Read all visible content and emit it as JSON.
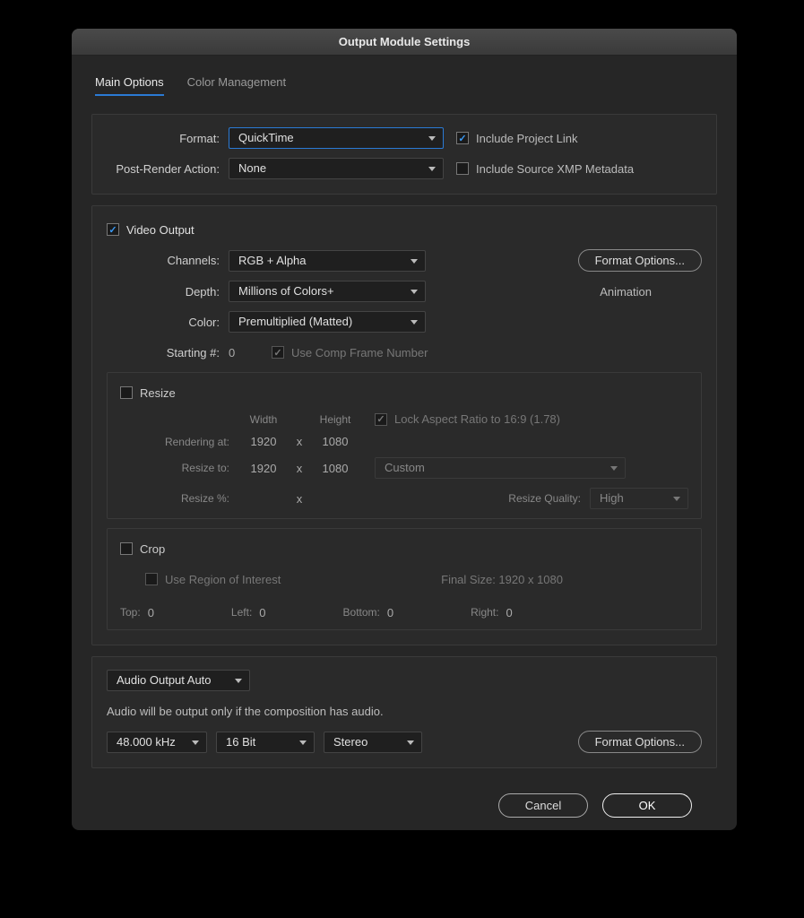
{
  "title": "Output Module Settings",
  "tabs": {
    "main": "Main Options",
    "color": "Color Management"
  },
  "format": {
    "label": "Format:",
    "value": "QuickTime",
    "post_render_label": "Post-Render Action:",
    "post_render_value": "None",
    "include_link": "Include Project Link",
    "include_xmp": "Include Source XMP Metadata"
  },
  "video": {
    "output": "Video Output",
    "channels_label": "Channels:",
    "channels_value": "RGB + Alpha",
    "depth_label": "Depth:",
    "depth_value": "Millions of Colors+",
    "color_label": "Color:",
    "color_value": "Premultiplied (Matted)",
    "starting_label": "Starting #:",
    "starting_value": "0",
    "use_comp": "Use Comp Frame Number",
    "format_options": "Format Options...",
    "codec": "Animation"
  },
  "resize": {
    "title": "Resize",
    "width": "Width",
    "height": "Height",
    "lock": "Lock Aspect Ratio to 16:9 (1.78)",
    "rendering_at": "Rendering at:",
    "r_w": "1920",
    "r_h": "1080",
    "resize_to": "Resize to:",
    "t_w": "1920",
    "t_h": "1080",
    "preset": "Custom",
    "resize_pct": "Resize %:",
    "x": "x",
    "quality_label": "Resize Quality:",
    "quality_value": "High"
  },
  "crop": {
    "title": "Crop",
    "roi": "Use Region of Interest",
    "final": "Final Size: 1920 x 1080",
    "top": "Top:",
    "top_v": "0",
    "left": "Left:",
    "left_v": "0",
    "bottom": "Bottom:",
    "bottom_v": "0",
    "right": "Right:",
    "right_v": "0"
  },
  "audio": {
    "mode": "Audio Output Auto",
    "note": "Audio will be output only if the composition has audio.",
    "rate": "48.000 kHz",
    "bit": "16 Bit",
    "channels": "Stereo",
    "format_options": "Format Options..."
  },
  "buttons": {
    "cancel": "Cancel",
    "ok": "OK"
  }
}
